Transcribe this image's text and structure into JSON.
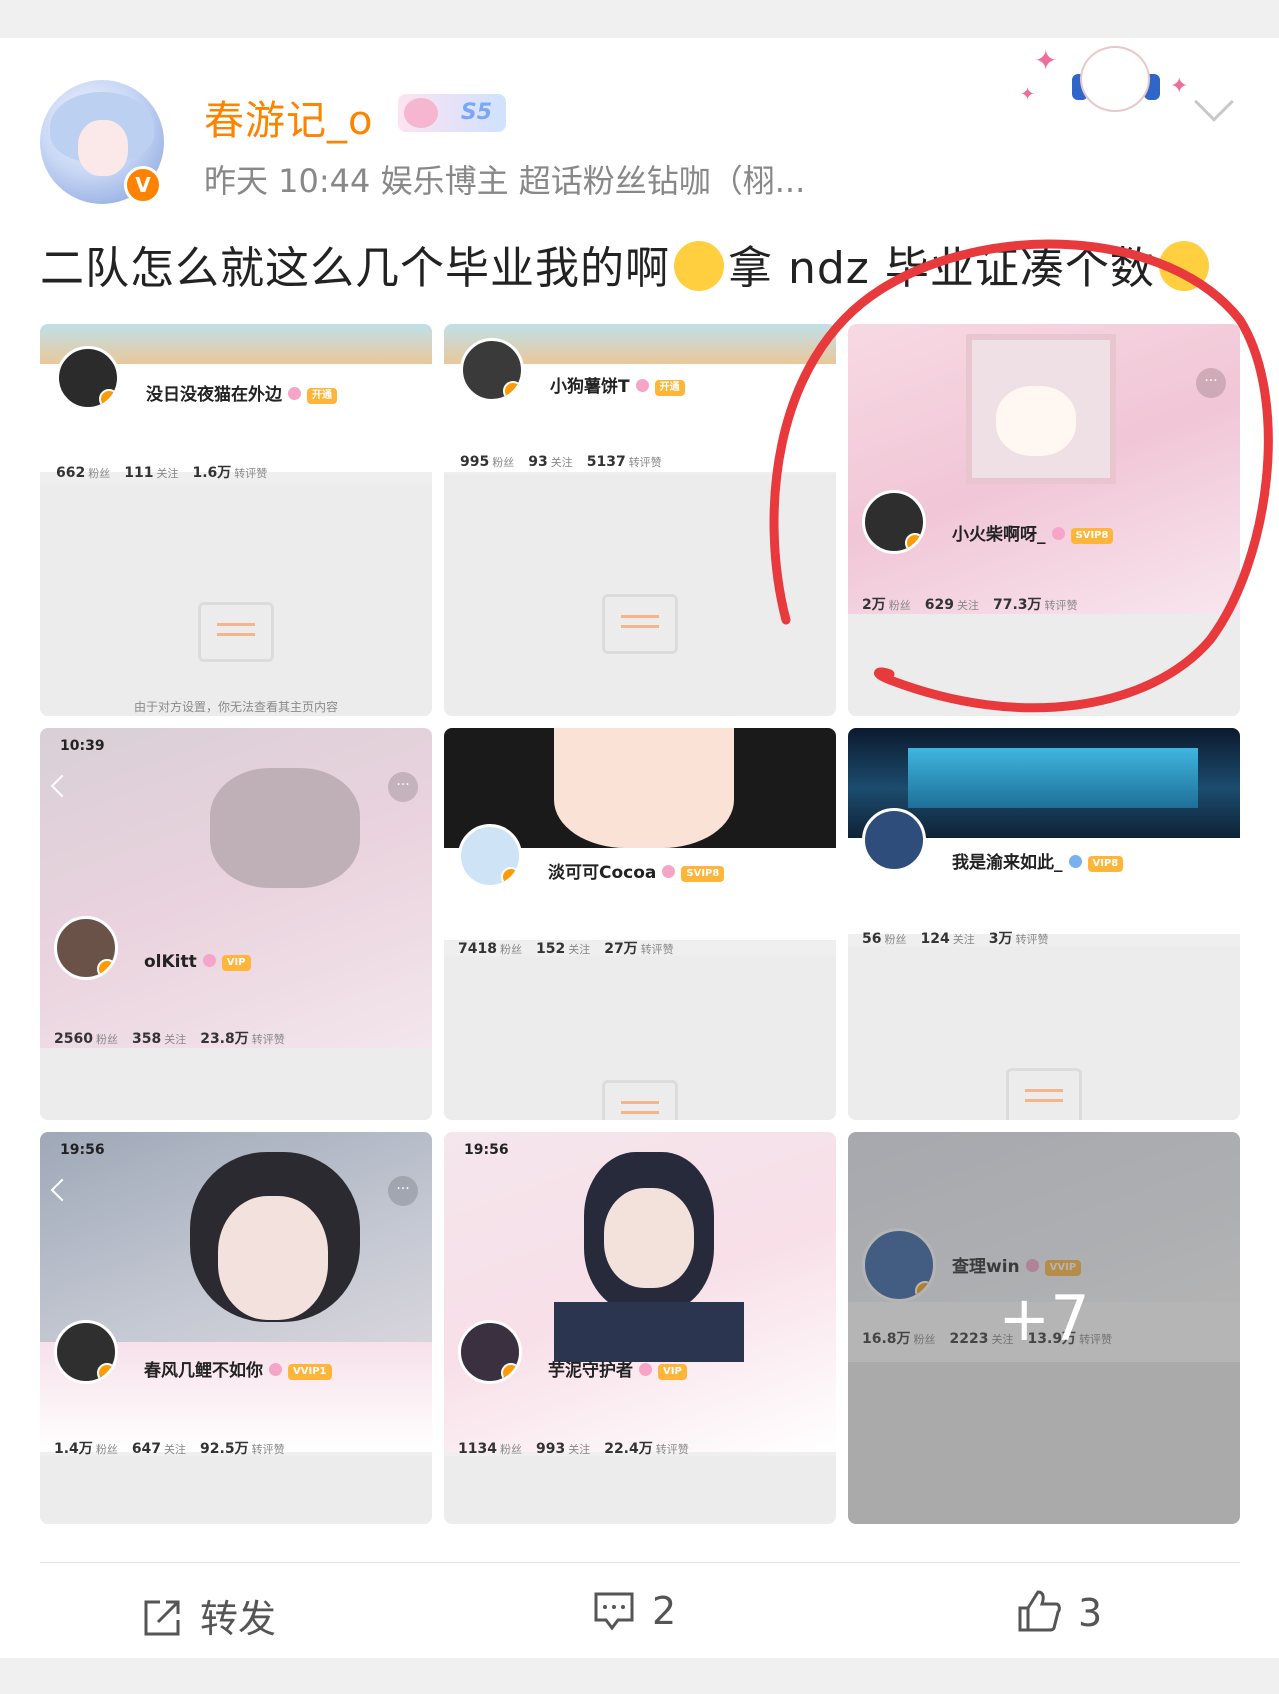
{
  "post": {
    "username": "春游记_o",
    "badge": "S5",
    "meta": "昨天 10:44  娱乐博主 超话粉丝钻咖（栩...",
    "text_part1": "二队怎么就这么几个毕业我的啊",
    "text_part2": "拿 ndz 毕业证凑个数"
  },
  "tiles": [
    {
      "name": "没日没夜猫在外边",
      "vip": "开通",
      "fans": "662",
      "fans_label": "粉丝",
      "follow": "111",
      "follow_label": "关注",
      "likes": "1.6万",
      "likes_label": "转评赞",
      "note": "由于对方设置，你无法查看其主页内容"
    },
    {
      "name": "小狗薯饼T",
      "vip": "开通",
      "fans": "995",
      "fans_label": "粉丝",
      "follow": "93",
      "follow_label": "关注",
      "likes": "5137",
      "likes_label": "转评赞"
    },
    {
      "name": "小火柴啊呀_",
      "vip": "SVIP8",
      "fans": "2万",
      "fans_label": "粉丝",
      "follow": "629",
      "follow_label": "关注",
      "likes": "77.3万",
      "likes_label": "转评赞"
    },
    {
      "status_time": "10:39",
      "name": "olKitt",
      "vip": "VIP",
      "fans": "2560",
      "fans_label": "粉丝",
      "follow": "358",
      "follow_label": "关注",
      "likes": "23.8万",
      "likes_label": "转评赞"
    },
    {
      "name": "淡可可Cocoa",
      "vip": "SVIP8",
      "fans": "7418",
      "fans_label": "粉丝",
      "follow": "152",
      "follow_label": "关注",
      "likes": "27万",
      "likes_label": "转评赞"
    },
    {
      "name": "我是渝来如此_",
      "vip": "VIP8",
      "fans": "56",
      "fans_label": "粉丝",
      "follow": "124",
      "follow_label": "关注",
      "likes": "3万",
      "likes_label": "转评赞"
    },
    {
      "status_time": "19:56",
      "name": "春风几鲤不如你",
      "vip": "VVIP1",
      "fans": "1.4万",
      "fans_label": "粉丝",
      "follow": "647",
      "follow_label": "关注",
      "likes": "92.5万",
      "likes_label": "转评赞"
    },
    {
      "status_time": "19:56",
      "name": "芋泥守护者",
      "vip": "VIP",
      "fans": "1134",
      "fans_label": "粉丝",
      "follow": "993",
      "follow_label": "关注",
      "likes": "22.4万",
      "likes_label": "转评赞"
    },
    {
      "name": "查理win",
      "vip": "VVIP",
      "fans": "16.8万",
      "fans_label": "粉丝",
      "follow": "2223",
      "follow_label": "关注",
      "likes": "13.9万",
      "likes_label": "转评赞",
      "more_count": "+7"
    }
  ],
  "actions": {
    "repost": "转发",
    "comments": "2",
    "likes": "3"
  },
  "icons": [
    "repost-icon",
    "comment-icon",
    "like-icon",
    "chevron-down-icon",
    "verified-icon"
  ],
  "colors": {
    "username": "#ff8200",
    "verified": "#ff8200",
    "annotation": "#e8393c"
  }
}
